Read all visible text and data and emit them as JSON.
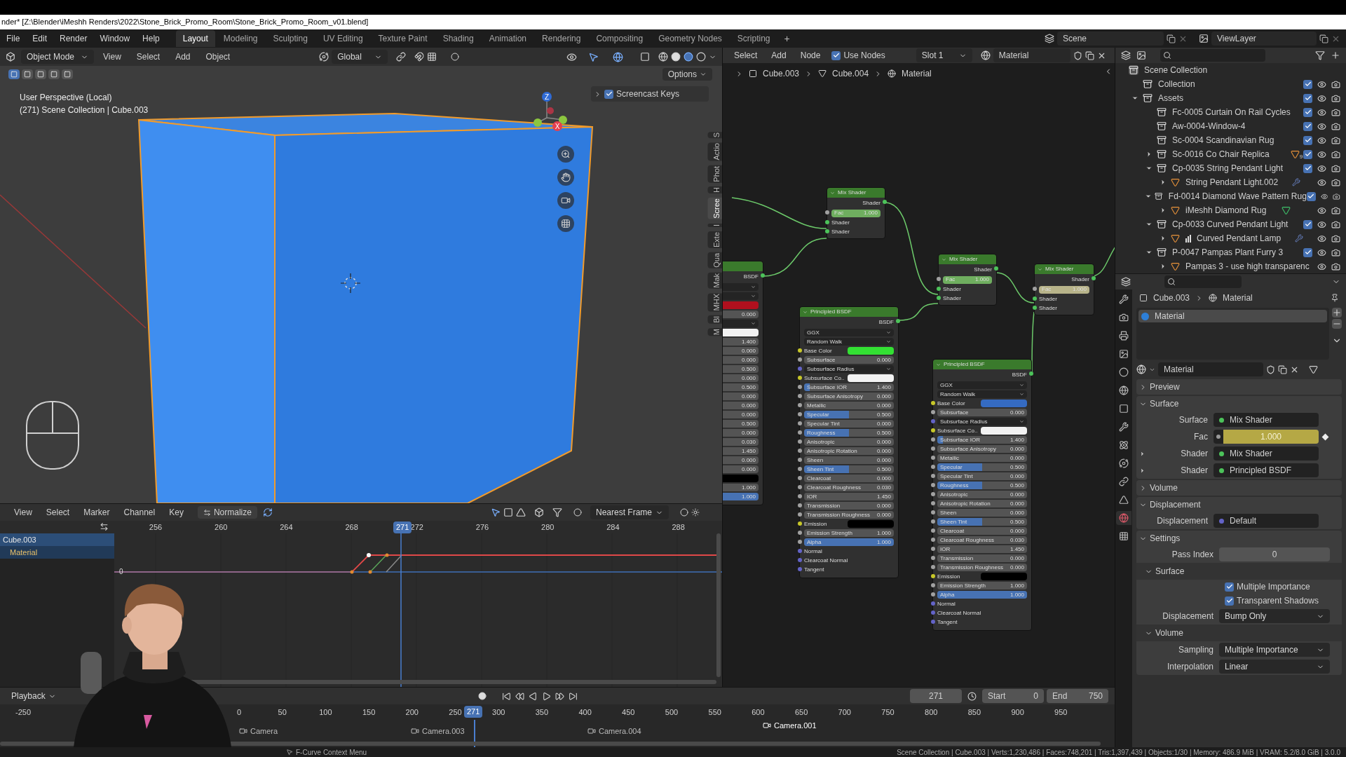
{
  "window": {
    "title": "nder* [Z:\\Blender\\iMeshh Renders\\2022\\Stone_Brick_Promo_Room\\Stone_Brick_Promo_Room_v01.blend]"
  },
  "menu": [
    "File",
    "Edit",
    "Render",
    "Window",
    "Help"
  ],
  "workspaces": [
    {
      "label": "Layout",
      "selected": true
    },
    {
      "label": "Modeling",
      "selected": false
    },
    {
      "label": "Sculpting",
      "selected": false
    },
    {
      "label": "UV Editing",
      "selected": false
    },
    {
      "label": "Texture Paint",
      "selected": false
    },
    {
      "label": "Shading",
      "selected": false
    },
    {
      "label": "Animation",
      "selected": false
    },
    {
      "label": "Rendering",
      "selected": false
    },
    {
      "label": "Compositing",
      "selected": false
    },
    {
      "label": "Geometry Nodes",
      "selected": false
    },
    {
      "label": "Scripting",
      "selected": false
    }
  ],
  "add_workspace": "+",
  "scene": "Scene",
  "view_layer": "ViewLayer",
  "viewport": {
    "mode": "Object Mode",
    "menus": [
      "View",
      "Select",
      "Add",
      "Object"
    ],
    "orientation": "Global",
    "options": "Options",
    "select_modes": [
      {
        "selected": true
      },
      {
        "selected": false
      },
      {
        "selected": false
      },
      {
        "selected": false
      },
      {
        "selected": false
      }
    ],
    "overlay": [
      "User Perspective (Local)",
      "(271) Scene Collection | Cube.003"
    ],
    "screencast_keys": {
      "label": "Screencast Keys",
      "checked": true
    },
    "gizmo": [
      "Z",
      "X"
    ],
    "side_tabs": [
      {
        "label": "S",
        "selected": false
      },
      {
        "label": "Actio",
        "selected": false
      },
      {
        "label": "Phot",
        "selected": false
      },
      {
        "label": "H",
        "selected": false
      },
      {
        "label": "Scree",
        "selected": true
      },
      {
        "label": "I",
        "selected": false
      },
      {
        "label": "Exte",
        "selected": false
      },
      {
        "label": "Qua",
        "selected": false
      },
      {
        "label": "Mak",
        "selected": false
      },
      {
        "label": "MHX",
        "selected": false
      },
      {
        "label": "Bl",
        "selected": false
      },
      {
        "label": "M",
        "selected": false
      }
    ]
  },
  "graph_editor": {
    "menus": [
      "View",
      "Select",
      "Marker",
      "Channel",
      "Key"
    ],
    "normalize": "Normalize",
    "snap": "Nearest Frame",
    "ticks": [
      "256",
      "260",
      "264",
      "268",
      "272",
      "276",
      "280",
      "284",
      "288"
    ],
    "current_frame": "271",
    "channels": [
      {
        "label": "Cube.003",
        "kind": "object"
      },
      {
        "label": "Material",
        "kind": "material"
      }
    ],
    "zero_label": "0"
  },
  "node_editor": {
    "menus": [
      "Select",
      "Add",
      "Node"
    ],
    "use_nodes": {
      "label": "Use Nodes",
      "checked": true
    },
    "slot": "Slot 1",
    "material": "Material",
    "breadcrumb": [
      "Cube.003",
      "Cube.004",
      "Material"
    ],
    "nodes": [
      {
        "kind": "partial",
        "output": "BSDF",
        "rows": [
          {
            "kind": "menu"
          },
          {
            "kind": "menu"
          },
          {
            "kind": "color",
            "color": "#b0101e"
          },
          {
            "kind": "value",
            "value": "0.000"
          },
          {
            "kind": "menu"
          },
          {
            "kind": "color",
            "color": "#f2f2f2"
          },
          {
            "kind": "value",
            "value": "1.400"
          },
          {
            "kind": "value",
            "value": "0.000"
          },
          {
            "kind": "value",
            "value": "0.000"
          },
          {
            "kind": "value",
            "value": "0.500"
          },
          {
            "kind": "value",
            "value": "0.000"
          },
          {
            "kind": "value",
            "value": "0.500"
          },
          {
            "kind": "value",
            "value": "0.000"
          },
          {
            "kind": "value",
            "value": "0.000"
          },
          {
            "kind": "value",
            "value": "0.000"
          },
          {
            "kind": "value",
            "value": "0.500"
          },
          {
            "kind": "value",
            "value": "0.000"
          },
          {
            "kind": "value",
            "value": "0.030"
          },
          {
            "kind": "value",
            "value": "1.450"
          },
          {
            "kind": "value",
            "value": "0.000"
          },
          {
            "kind": "value",
            "value": "0.000"
          },
          {
            "kind": "color",
            "color": "#000000"
          },
          {
            "kind": "value",
            "value": "1.000"
          },
          {
            "kind": "value",
            "value": "1.000",
            "level": 1
          }
        ]
      },
      {
        "kind": "mix",
        "title": "Mix Shader",
        "output": "Shader",
        "fac": {
          "label": "Fac",
          "value": "1.000",
          "level": 1,
          "color": "#6fae5f"
        },
        "inputs": [
          "Shader",
          "Shader"
        ]
      },
      {
        "kind": "mix",
        "title": "Mix Shader",
        "output": "Shader",
        "fac": {
          "label": "Fac",
          "value": "1.000",
          "level": 1,
          "color": "#6fae5f"
        },
        "inputs": [
          "Shader",
          "Shader"
        ]
      },
      {
        "kind": "mix",
        "title": "Mix Shader",
        "output": "Shader",
        "fac": {
          "label": "Fac",
          "value": "1.000",
          "level": 1,
          "color": "#b8b48a"
        },
        "inputs": [
          "Shader",
          "Shader"
        ]
      },
      {
        "kind": "principled",
        "title": "Principled BSDF",
        "output": "BSDF",
        "rows": [
          {
            "kind": "menu",
            "label": "GGX"
          },
          {
            "kind": "menu",
            "label": "Random Walk"
          },
          {
            "kind": "color",
            "label": "Base Color",
            "color": "#33e033"
          },
          {
            "kind": "value",
            "label": "Subsurface",
            "value": "0.000"
          },
          {
            "kind": "vector-menu",
            "label": "Subsurface Radius"
          },
          {
            "kind": "color",
            "label": "Subsurface Co..",
            "color": "#f2f2f2"
          },
          {
            "kind": "value",
            "label": "Subsurface IOR",
            "value": "1.400",
            "level": 0.06
          },
          {
            "kind": "value",
            "label": "Subsurface Anisotropy",
            "value": "0.000"
          },
          {
            "kind": "value",
            "label": "Metallic",
            "value": "0.000"
          },
          {
            "kind": "value",
            "label": "Specular",
            "value": "0.500",
            "level": 0.5
          },
          {
            "kind": "value",
            "label": "Specular Tint",
            "value": "0.000"
          },
          {
            "kind": "value",
            "label": "Roughness",
            "value": "0.500",
            "level": 0.5
          },
          {
            "kind": "value",
            "label": "Anisotropic",
            "value": "0.000"
          },
          {
            "kind": "value",
            "label": "Anisotropic Rotation",
            "value": "0.000"
          },
          {
            "kind": "value",
            "label": "Sheen",
            "value": "0.000"
          },
          {
            "kind": "value",
            "label": "Sheen Tint",
            "value": "0.500",
            "level": 0.5
          },
          {
            "kind": "value",
            "label": "Clearcoat",
            "value": "0.000"
          },
          {
            "kind": "value",
            "label": "Clearcoat Roughness",
            "value": "0.030"
          },
          {
            "kind": "value",
            "label": "IOR",
            "value": "1.450"
          },
          {
            "kind": "value",
            "label": "Transmission",
            "value": "0.000"
          },
          {
            "kind": "value",
            "label": "Transmission Roughness",
            "value": "0.000"
          },
          {
            "kind": "color",
            "label": "Emission",
            "color": "#000000"
          },
          {
            "kind": "value",
            "label": "Emission Strength",
            "value": "1.000"
          },
          {
            "kind": "value",
            "label": "Alpha",
            "value": "1.000",
            "level": 1
          },
          {
            "kind": "vector",
            "label": "Normal"
          },
          {
            "kind": "vector",
            "label": "Clearcoat Normal"
          },
          {
            "kind": "vector",
            "label": "Tangent"
          }
        ]
      },
      {
        "kind": "principled",
        "title": "Principled BSDF",
        "output": "BSDF",
        "rows": [
          {
            "kind": "menu",
            "label": "GGX"
          },
          {
            "kind": "menu",
            "label": "Random Walk"
          },
          {
            "kind": "color",
            "label": "Base Color",
            "color": "#356bc2"
          },
          {
            "kind": "value",
            "label": "Subsurface",
            "value": "0.000"
          },
          {
            "kind": "vector-menu",
            "label": "Subsurface Radius"
          },
          {
            "kind": "color",
            "label": "Subsurface Co..",
            "color": "#f2f2f2"
          },
          {
            "kind": "value",
            "label": "Subsurface IOR",
            "value": "1.400",
            "level": 0.06
          },
          {
            "kind": "value",
            "label": "Subsurface Anisotropy",
            "value": "0.000"
          },
          {
            "kind": "value",
            "label": "Metallic",
            "value": "0.000"
          },
          {
            "kind": "value",
            "label": "Specular",
            "value": "0.500",
            "level": 0.5
          },
          {
            "kind": "value",
            "label": "Specular Tint",
            "value": "0.000"
          },
          {
            "kind": "value",
            "label": "Roughness",
            "value": "0.500",
            "level": 0.5
          },
          {
            "kind": "value",
            "label": "Anisotropic",
            "value": "0.000"
          },
          {
            "kind": "value",
            "label": "Anisotropic Rotation",
            "value": "0.000"
          },
          {
            "kind": "value",
            "label": "Sheen",
            "value": "0.000"
          },
          {
            "kind": "value",
            "label": "Sheen Tint",
            "value": "0.500",
            "level": 0.5
          },
          {
            "kind": "value",
            "label": "Clearcoat",
            "value": "0.000"
          },
          {
            "kind": "value",
            "label": "Clearcoat Roughness",
            "value": "0.030"
          },
          {
            "kind": "value",
            "label": "IOR",
            "value": "1.450"
          },
          {
            "kind": "value",
            "label": "Transmission",
            "value": "0.000"
          },
          {
            "kind": "value",
            "label": "Transmission Roughness",
            "value": "0.000"
          },
          {
            "kind": "color",
            "label": "Emission",
            "color": "#000000"
          },
          {
            "kind": "value",
            "label": "Emission Strength",
            "value": "1.000"
          },
          {
            "kind": "value",
            "label": "Alpha",
            "value": "1.000",
            "level": 1
          },
          {
            "kind": "vector",
            "label": "Normal"
          },
          {
            "kind": "vector",
            "label": "Clearcoat Normal"
          },
          {
            "kind": "vector",
            "label": "Tangent"
          }
        ]
      }
    ]
  },
  "outliner": {
    "items": [
      {
        "name": "Scene Collection",
        "kind": "scene",
        "children": [
          {
            "name": "Collection",
            "kind": "collection",
            "checked": true
          },
          {
            "name": "Assets",
            "kind": "collection",
            "checked": true,
            "expanded": true,
            "children": [
              {
                "name": "Fc-0005 Curtain On Rail Cycles",
                "kind": "collection",
                "checked": true
              },
              {
                "name": "Aw-0004-Window-4",
                "kind": "collection",
                "checked": true
              },
              {
                "name": "Sc-0004 Scandinavian Rug",
                "kind": "collection",
                "checked": true
              },
              {
                "name": "Sc-0016 Co Chair Replica",
                "kind": "collection",
                "checked": true,
                "expanded": false,
                "badge": {
                  "kind": "mesh",
                  "count": "9"
                }
              },
              {
                "name": "Cp-0035 String Pendant Light",
                "kind": "collection",
                "checked": true,
                "expanded": true,
                "children": [
                  {
                    "name": "String Pendant Light.002",
                    "kind": "object",
                    "expanded": false,
                    "badge": {
                      "kind": "wrench"
                    }
                  }
                ]
              },
              {
                "name": "Fd-0014 Diamond Wave Pattern Rug",
                "kind": "collection",
                "checked": true,
                "expanded": true,
                "children": [
                  {
                    "name": "iMeshh Diamond Rug",
                    "kind": "object",
                    "expanded": false,
                    "badge": {
                      "kind": "particles"
                    }
                  }
                ]
              },
              {
                "name": "Cp-0033 Curved Pendant Light",
                "kind": "collection",
                "checked": true,
                "expanded": true,
                "children": [
                  {
                    "name": "Curved Pendant Lamp",
                    "kind": "object",
                    "expanded": false,
                    "modifier": {
                      "kind": "bars"
                    },
                    "badge": {
                      "kind": "wrench"
                    }
                  }
                ]
              },
              {
                "name": "P-0047 Pampas Plant Furry 3",
                "kind": "collection",
                "checked": true,
                "expanded": true,
                "children": [
                  {
                    "name": "Pampas 3 - use high transparenc",
                    "kind": "object",
                    "expanded": false
                  }
                ]
              }
            ]
          }
        ]
      }
    ]
  },
  "properties": {
    "tabs": [
      {
        "kind": "tool",
        "selected": false
      },
      {
        "kind": "render",
        "selected": false
      },
      {
        "kind": "output",
        "selected": false
      },
      {
        "kind": "view-layer",
        "selected": false
      },
      {
        "kind": "scene",
        "selected": false
      },
      {
        "kind": "world",
        "selected": false
      },
      {
        "kind": "object",
        "selected": false
      },
      {
        "kind": "modifiers",
        "selected": false
      },
      {
        "kind": "particles",
        "selected": false
      },
      {
        "kind": "physics",
        "selected": false
      },
      {
        "kind": "constraints",
        "selected": false
      },
      {
        "kind": "data",
        "selected": false
      },
      {
        "kind": "material",
        "selected": true
      },
      {
        "kind": "texture",
        "selected": false
      }
    ],
    "breadcrumb": [
      "Cube.003",
      "Material"
    ],
    "slots": [
      {
        "label": "Material",
        "selected": true
      }
    ],
    "material": "Material",
    "panels": [
      {
        "title": "Preview",
        "expanded": false
      },
      {
        "title": "Surface",
        "expanded": true,
        "rows": [
          {
            "kind": "link",
            "label": "Surface",
            "value": "Mix Shader",
            "color": "#4cc35a"
          },
          {
            "kind": "slider",
            "label": "Fac",
            "value": "1.000",
            "level": 1
          },
          {
            "kind": "link",
            "label": "Shader",
            "value": "Mix Shader",
            "color": "#4cc35a",
            "expanded": false
          },
          {
            "kind": "link",
            "label": "Shader",
            "value": "Principled BSDF",
            "color": "#4cc35a",
            "expanded": false
          }
        ]
      },
      {
        "title": "Volume",
        "expanded": false
      },
      {
        "title": "Displacement",
        "expanded": true,
        "rows": [
          {
            "kind": "link",
            "label": "Displacement",
            "value": "Default",
            "color": "#6363c7"
          }
        ]
      },
      {
        "title": "Settings",
        "expanded": true,
        "rows": [
          {
            "kind": "number",
            "label": "Pass Index",
            "value": "0"
          },
          {
            "kind": "subpanel",
            "label": "Surface",
            "expanded": true
          },
          {
            "kind": "check",
            "label": "Multiple Importance",
            "checked": true
          },
          {
            "kind": "check",
            "label": "Transparent Shadows",
            "checked": true
          },
          {
            "kind": "select",
            "label": "Displacement",
            "value": "Bump Only"
          },
          {
            "kind": "subpanel",
            "label": "Volume",
            "expanded": true
          },
          {
            "kind": "select",
            "label": "Sampling",
            "value": "Multiple Importance"
          },
          {
            "kind": "select",
            "label": "Interpolation",
            "value": "Linear"
          }
        ]
      }
    ]
  },
  "timeline": {
    "playback": "Playback",
    "frame": "271",
    "start_label": "Start",
    "start": "0",
    "end_label": "End",
    "end": "750",
    "ticks": [
      "-250",
      "0",
      "50",
      "100",
      "150",
      "200",
      "250",
      "300",
      "350",
      "400",
      "450",
      "500",
      "550",
      "600",
      "650",
      "700",
      "750",
      "800",
      "850",
      "900",
      "950"
    ],
    "current_frame": "271",
    "markers": [
      {
        "label": "Camera",
        "selected": false
      },
      {
        "label": "Camera.003",
        "selected": false
      },
      {
        "label": "Camera.004",
        "selected": false
      },
      {
        "label": "Camera.001",
        "selected": true
      }
    ]
  },
  "status_bar": {
    "hint": "F-Curve Context Menu",
    "stats": "Scene Collection | Cube.003 | Verts:1,230,486 | Faces:748,201 | Tris:1,397,439 | Objects:1/30 | Memory: 486.9 MiB | VRAM: 5.2/8.0 GiB | 3.0.0"
  }
}
